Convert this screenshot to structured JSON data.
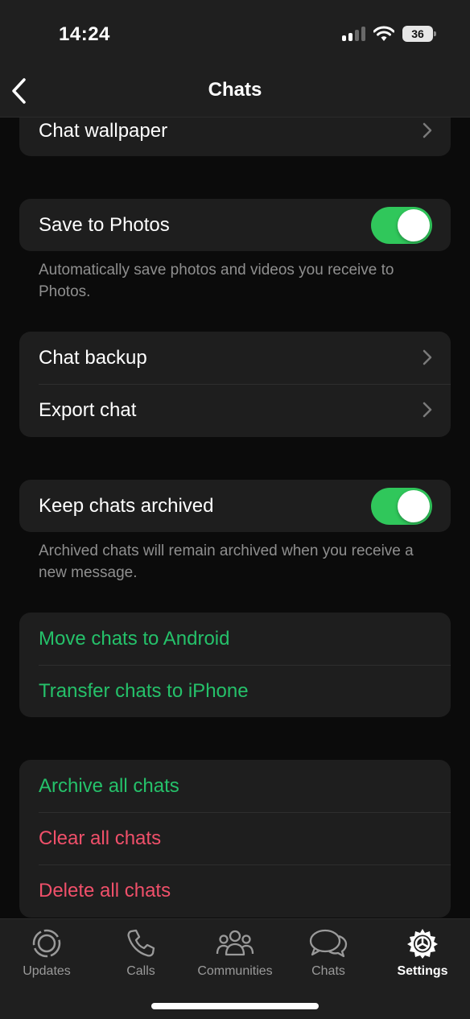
{
  "status": {
    "time": "14:24",
    "battery": "36"
  },
  "nav": {
    "title": "Chats"
  },
  "sections": {
    "wallpaper": {
      "label": "Chat wallpaper"
    },
    "save_photos": {
      "label": "Save to Photos",
      "toggle_on": true,
      "note": "Automatically save photos and videos you receive to Photos."
    },
    "backup": {
      "chat_backup": "Chat backup",
      "export_chat": "Export chat"
    },
    "archived": {
      "label": "Keep chats archived",
      "toggle_on": true,
      "note": "Archived chats will remain archived when you receive a new message."
    },
    "transfer": {
      "android": "Move chats to Android",
      "iphone": "Transfer chats to iPhone"
    },
    "bulk": {
      "archive_all": "Archive all chats",
      "clear_all": "Clear all chats",
      "delete_all": "Delete all chats"
    }
  },
  "tabs": [
    {
      "label": "Updates",
      "icon": "updates-icon"
    },
    {
      "label": "Calls",
      "icon": "phone-icon"
    },
    {
      "label": "Communities",
      "icon": "communities-icon"
    },
    {
      "label": "Chats",
      "icon": "chat-bubbles-icon"
    },
    {
      "label": "Settings",
      "icon": "gear-icon",
      "active": true
    }
  ],
  "colors": {
    "accent_green": "#25c16a",
    "destructive_red": "#f0506a",
    "toggle_green": "#30c75b"
  }
}
